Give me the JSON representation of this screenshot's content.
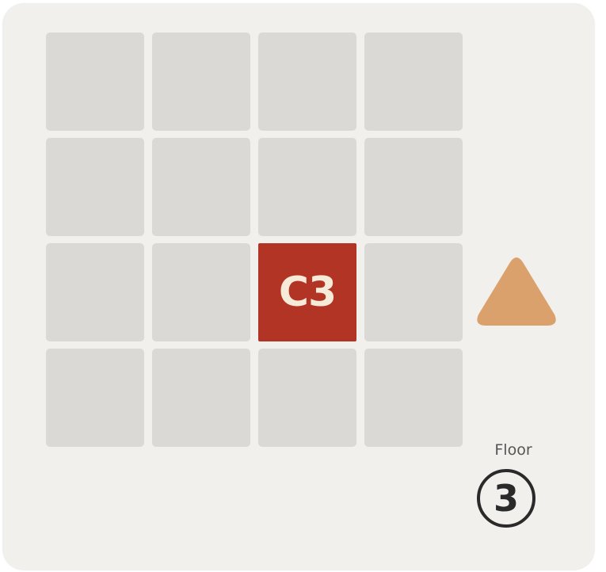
{
  "board": {
    "rows": 4,
    "columns": 4,
    "active_tile": {
      "row": 3,
      "column": 3,
      "label": "C3"
    },
    "colors": {
      "tile": "#dad9d5",
      "active_tile": "#b23425",
      "active_label": "#f6ead8",
      "background": "#f1f0ec"
    }
  },
  "direction_marker": {
    "icon": "triangle-up-icon",
    "color": "#dba16c"
  },
  "floor": {
    "label": "Floor",
    "number": "3"
  }
}
